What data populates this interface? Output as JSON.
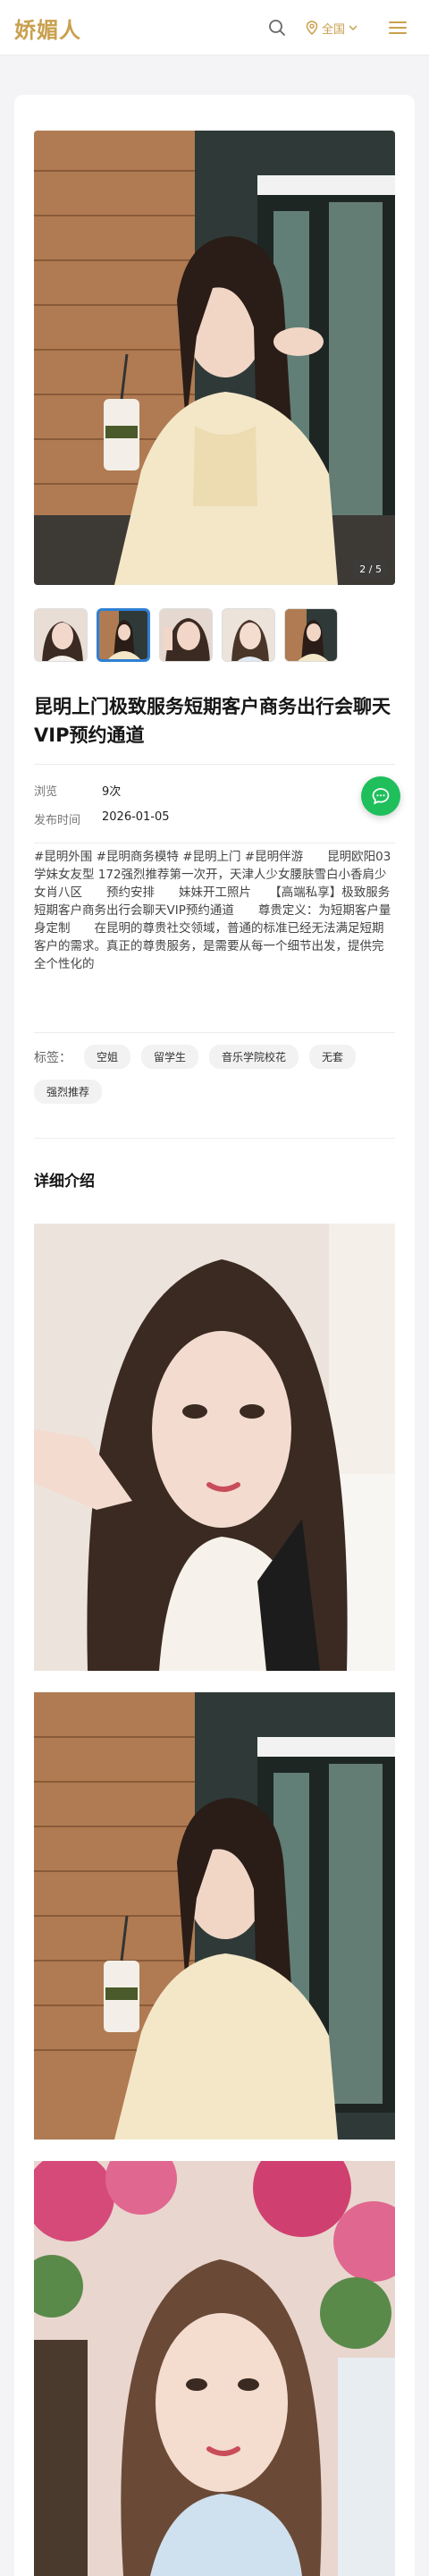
{
  "header": {
    "logo": "娇媚人",
    "region_label": "全国",
    "search_icon": "search-icon",
    "location_icon": "location-pin-icon",
    "menu_icon": "hamburger-menu-icon"
  },
  "gallery": {
    "counter": "2 / 5",
    "thumbnail_count": 5,
    "active_thumbnail": 2
  },
  "profile": {
    "title": "昆明上门极致服务短期客户商务出行会聊天VIP预约通道",
    "views_label": "浏览",
    "views_value": "9次",
    "date_label": "发布时间",
    "date_value": "2026-01-05",
    "description": "#昆明外围 #昆明商务模特 #昆明上门 #昆明伴游　　昆明欧阳03学妹女友型 172强烈推荐第一次开，天津人少女腰肤雪白小香肩少女肖八区　　预约安排　　妹妹开工照片　　【高端私享】极致服务短期客户商务出行会聊天VIP预约通道　　尊贵定义：为短期客户量身定制　　在昆明的尊贵社交领域，普通的标准已经无法满足短期客户的需求。真正的尊贵服务，是需要从每一个细节出发，提供完全个性化的",
    "tags_label": "标签：",
    "tags": [
      "空姐",
      "留学生",
      "音乐学院校花",
      "无套",
      "强烈推荐"
    ]
  },
  "detail": {
    "section_title": "详细介绍"
  },
  "chat_button": {
    "icon": "chat-bubble-icon"
  },
  "colors": {
    "brand_gold": "#c9a04e",
    "active_thumb_border": "#2f7fd4",
    "chat_green": "#1fbf5c"
  }
}
